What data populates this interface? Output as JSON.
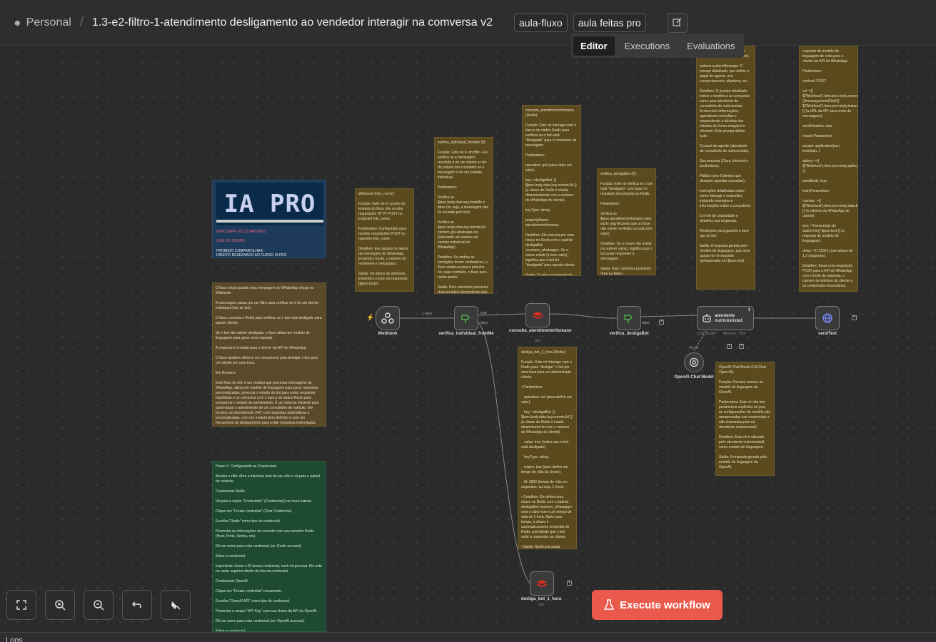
{
  "header": {
    "project": "Personal",
    "workflow_title": "1.3-e2-filtro-1-atendimento desligamento ao vendedor interagir na comversa v2",
    "tags": [
      "aula-fluxo",
      "aula feitas pro"
    ]
  },
  "tabs": [
    {
      "label": "Editor",
      "active": true
    },
    {
      "label": "Executions",
      "active": false
    },
    {
      "label": "Evaluations",
      "active": false
    }
  ],
  "banner": {
    "image_text": "IA PRO",
    "whatsapp": "WHATSAPP +55 31 8469-9853",
    "group_link": "LINK DO GRUPO",
    "line1": "PROIBIDO COMPARTILHAR",
    "line2": "DIREITO RESERVADO AO CURSO IA PRO"
  },
  "notes": {
    "overview": "O fluxo inicia quando uma mensagem do WhatsApp chega no Webhook.\n\nA mensagem passa por um filtro para verificar se é de um cliente individual (não do bot).\n\nO fluxo consulta o Redis para verificar se o bot está desligado para aquele cliente.\n\nSe o bot não estiver desligado, o fluxo utiliza um modelo de linguagem para gerar uma resposta.\n\nA resposta é enviada para o cliente via API do WhatsApp.\n\nO fluxo também oferece um mecanismo para desligar o bot para um cliente por uma hora.\n\nEm Resumo:\n\nEste fluxo do n8n é um chatbot que processa mensagens do WhatsApp, utiliza um modelo de linguagem para gerar respostas personalizadas, gerencia o estado do bot para evitar respostas repetitivas e se comunica com o banco de dados Redis para armazenar o estado do atendimento. É um sistema eficiente para automatizar o atendimento de um consultório de nutrição. Ele fornece um atendimento 24/7 com respostas automáticas e personalizadas, com um modelo bem definido e com um mecanismo de desligamento para evitar respostas indesejadas.",
    "webhook": "Webhook (foto_nome):\n\nFunção: Este nó é o ponto de entrada do fluxo. Ele recebe requisições HTTP POST no endpoint foto_nome.\n\nParâmetros: Configurado para receber requisições POST no caminho foto_nome.\n\nDetalhes: Ele captura os dados da mensagem do WhatsApp, incluindo o texto, o número do remetente e metadados.\n\nSaída: Os dados do webhook, incluindo o corpo da requisição ($json.body).",
    "verifica": "verifica_individual_fromMe (If):\n\nFunção: Este nó é um filtro. Ele verifica se a mensagem recebida é de um cliente e não do próprio bot e também se a mensagem é de um contato individual.\n\nParâmetros:\n\nVerifica se $json.body.data.key.fromMe é false (ou seja, a mensagem não foi enviada pelo bot).\n\nVerifica se $json.body.data.key.remoteJid contém @s.whatsapp.net (indicando um número de contato individual do WhatsApp).\n\nDetalhes: Se ambas as condições forem verdadeiras, o fluxo continua para o próximo nó; caso contrário, o fluxo para nesse ponto.\n\nSaída: Dois caminhos possíveis (true ou false) dependendo das condições.",
    "consulta": "consulta_atendimentoHumano (Redis):\n\nFunção: Este nó interage com o banco de dados Redis para verificar se o bot está \"desligado\" para o remetente da mensagem.\n\nParâmetros:\n\noperation: get (para obter um valor).\n\nkey: =desligaBot: {{ $json.body.data.key.remoteJid }} (a chave do Redis é criada dinamicamente com o número do WhatsApp do cliente).\n\nkeyType: string.\n\npropertyName: atendimentoHumano.\n\nDetalhes: Ele procura por uma chave no Redis com o padrão desligaBot:<numero_whatsapp>. Se a chave existir (e tiver valor), significa que o bot foi \"desligado\" para aquele cliente.\n\nSaída: O valor recuperado do Redis, armazenado em $json.atendimentoHumano.",
    "verifica_bot": "verifica_desligaBot (If):\n\nFunção: Este nó verifica se o bot está \"desligado\" com base no resultado da consulta ao Redis.\n\nParâmetros:\n\nVerifica se $json.atendimentoHumano está vazio (significando que a chave não existe no Redis ou está sem valor).\n\nDetalhes: Se a chave não existir (ou estiver vazia), significa que o bot pode responder à mensagem.\n\nSaída: Dois caminhos possíveis (true ou false).",
    "agent": "text: ={{ $json.chatInput }} (o texto da mensagem do cliente).\n\noptions.systemMessage: O prompt detalhado, que define o papel do agente, seu comportamento, objetivos, etc.\n\nDetalhes: O prompt detalhado instrui o modelo a se comportar como uma atendente de consultório de nutricionista, fornecendo informações, agendando consultas e respondendo a dúvidas dos clientes de forma amigável e eficiente. Este prompt define tudo:\n\nO papel do agente (atendente de consultório de nutricionista).\n\nSua persona (Clara, informal e acolhedora).\n\nPúblico alvo (Clientes que desejam agendar consultas).\n\nInstruções detalhadas sobre como interagir e responder, incluindo exemplos e informações sobre o consultório.\n\nO nível de criatividade e detalhes nas respostas.\n\nRestrições para garantir o bom uso do bot\n\nSaída: A resposta gerada pelo modelo de linguagem, que será usada no nó seguinte (armazenado em $json.text).",
    "send": "resposta do modelo de linguagem de volta para o cliente via API do WhatsApp.\n\nParâmetros:\n\nmethod: POST.\n\nurl: ={{ $('Webhook').item.json.body.server_url }}/message/sendText/{{ $('Webhook').item.json.body.instance }} (a URL da API para envio de mensagens).\n\nsendHeaders: true.\n\nheaderParameters:\n\naccept: application/json, text/plain, /.\n\napikey: ={{ $('Webhook').item.json.body.apikey }}.\n\nsendBody: true.\n\nbodyParameters:\n\nnumber: ={{ $('Webhook').item.json.body.data.key.remoteJid }} (o número do WhatsApp do cliente).\n\ntext: =Transcrição de áudio:\\n\\n{{ $json.text }} (a resposta do modelo de linguagem).\n\ndelay: ={{ 1200 }} (um atraso de 1,2 segundos).\n\nDetalhes: Envia uma requisição POST para a API do WhatsApp com o texto da resposta, o número de telefone do cliente e as credenciais necessárias.\n\nSaída: A resposta da API.",
    "desliga": "desliga_bot_1_hora (Redis):\n\nFunção: Este nó interage com o Redis para \"desligar\" o bot por uma hora para um determinado cliente.\n\n• Parâmetros:\n\n   operation: set (para definir um valor).\n\n   key: =desligaBot: {{ $json.body.data.key.remoteJid }} (a chave do Redis é criada dinamicamente com o número do WhatsApp do cliente).\n\n   value: true (indica que o bot está desligado).\n\n   keyType: string.\n\n   expire: true (para definir um tempo de vida da chave).\n\n   ttl: 3600 (tempo de vida em segundos, ou seja, 1 hora).\n\n• Detalhes: Ele define uma chave no Redis com o padrão desligaBot:<numero_whatsapp> com o valor true e um tempo de vida de 1 hora. Após esse tempo, a chave é automaticamente removida do Redis, permitindo que o bot volte a responder ao cliente.\n\n• Saída: Nenhuma saída relevante para o fluxo.",
    "openai": "OpenAI Chat Model (LM Chat Open AI):\n\nFunção: Fornece acesso ao modelo de linguagem da OpenAI.\n\nParâmetros: Este nó não tem parâmetros explícitos no json, as configurações do modelo são armazenadas nas credenciais e são chamadas pelo nó atendente nutricionista1.\n\nDetalhes: Este nó é utilizado pelo atendente nutricionista1 como modelo de linguagem.\n\nSaída: A resposta gerada pelo modelo de linguagem da OpenAI.",
    "credentials": "Passo 1: Configurando as Credenciais\n\nAcesse o n8n: Abra a interface web do seu n8n e vá para o painel de controle.\n\nCredenciais Redis:\n\nVá para a seção \"Credentials\" (Credenciais) no menu lateral.\n\nClique em \"Create credential\" (Criar Credencial).\n\nEscolha \"Redis\" como tipo de credencial.\n\nPreencha as informações de conexão com seu servidor Redis (Host, Porta, Senha, etc).\n\nDê um nome para esta credencial (ex: Redis account).\n\nSalve a credencial.\n\nImportante: Anote o ID dessa credencial, você irá precisar. Ele está no canto superior direito da tela da credencial.\n\nCredenciais OpenAI:\n\nClique em \"Create credential\" novamente.\n\nEscolha \"OpenAI API\" como tipo de credencial.\n\nPreencha o campo \"API Key\" com sua chave da API da OpenAI.\n\nDê um nome para esta credencial (ex: OpenAI account).\n\nSalve a credencial.\n\nImportante: Anote o ID dessa credencial, você irá precisar. Ele"
  },
  "nodes": {
    "webhook": "Webhook",
    "verifica": "verifica_individual_fromMe",
    "consulta": "consulta_atendimentoHumano",
    "consulta_sub": "Get",
    "verifica_bot": "verifica_desligaBot",
    "agent": "atendente nutricionista1",
    "agent_badge": "1",
    "agent_ports": [
      "Chat Model*",
      "Memory",
      "Tool"
    ],
    "openai": "OpenAI Chat Model",
    "openai_port": "Model",
    "send": "sendText",
    "desliga": "desliga_bot_1_hora",
    "desliga_sub": "Set"
  },
  "edge_labels": {
    "true": "true",
    "false": "false",
    "items": "1 item"
  },
  "controls": {
    "execute": "Execute workflow",
    "logs": "Logs"
  }
}
